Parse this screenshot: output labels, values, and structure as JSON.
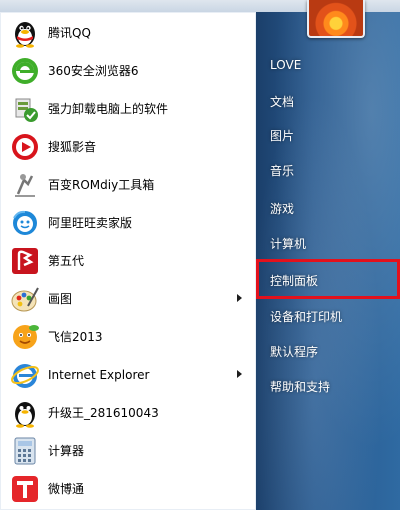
{
  "start_menu": {
    "programs": [
      {
        "label": "腾讯QQ",
        "icon": "qq-penguin-icon"
      },
      {
        "label": "360安全浏览器6",
        "icon": "360-browser-icon"
      },
      {
        "label": "强力卸载电脑上的软件",
        "icon": "uninstaller-icon"
      },
      {
        "label": "搜狐影音",
        "icon": "sohu-video-icon"
      },
      {
        "label": "百变ROMdiy工具箱",
        "icon": "romdiy-icon"
      },
      {
        "label": "阿里旺旺卖家版",
        "icon": "aliwangwang-icon"
      },
      {
        "label": "第五代",
        "icon": "diwudai-icon"
      },
      {
        "label": "画图",
        "icon": "paint-icon",
        "has_submenu": true
      },
      {
        "label": "飞信2013",
        "icon": "fetion-icon"
      },
      {
        "label": "Internet Explorer",
        "icon": "ie-icon",
        "has_submenu": true
      },
      {
        "label": "升级王_281610043",
        "icon": "penguin-icon"
      },
      {
        "label": "计算器",
        "icon": "calculator-icon"
      },
      {
        "label": "微博通",
        "icon": "weibotong-icon"
      }
    ],
    "right_items": [
      {
        "label": "LOVE"
      },
      {
        "label": "文档"
      },
      {
        "label": "图片"
      },
      {
        "label": "音乐"
      },
      {
        "label": "游戏"
      },
      {
        "label": "计算机"
      },
      {
        "label": "控制面板",
        "highlighted": true
      },
      {
        "label": "设备和打印机"
      },
      {
        "label": "默认程序"
      },
      {
        "label": "帮助和支持"
      }
    ],
    "colors": {
      "highlight_border": "#e3111c",
      "right_pane": "#28598e"
    }
  }
}
